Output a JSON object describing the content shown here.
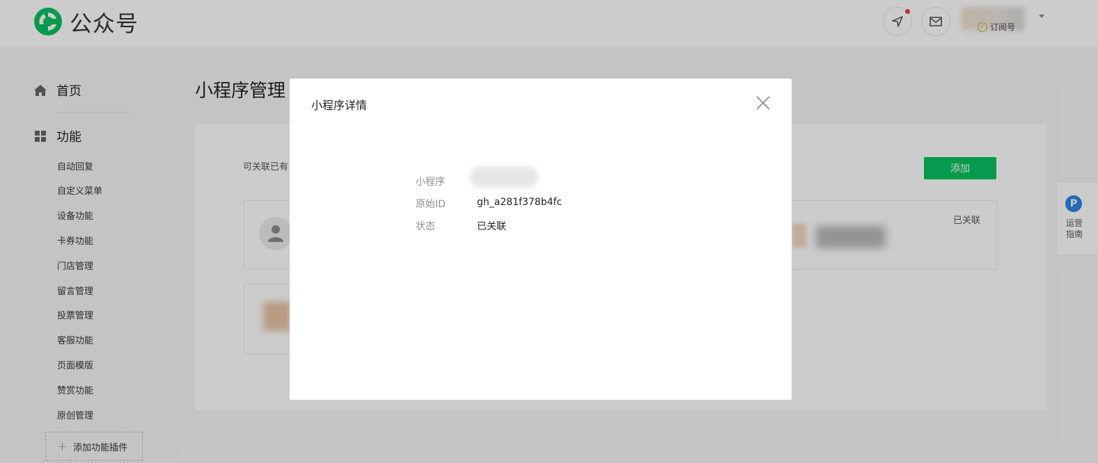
{
  "app": {
    "brand": "公众号",
    "account_type": "订阅号"
  },
  "sidebar": {
    "home": "首页",
    "features": "功能",
    "items": [
      {
        "label": "自动回复"
      },
      {
        "label": "自定义菜单"
      },
      {
        "label": "设备功能"
      },
      {
        "label": "卡券功能"
      },
      {
        "label": "门店管理"
      },
      {
        "label": "留言管理"
      },
      {
        "label": "投票管理"
      },
      {
        "label": "客服功能"
      },
      {
        "label": "页面模版"
      },
      {
        "label": "赞赏功能"
      },
      {
        "label": "原创管理"
      }
    ],
    "add_plugin": "添加功能插件"
  },
  "main": {
    "title": "小程序管理",
    "description": "可关联已有",
    "add_button": "添加",
    "row_status": "已关联"
  },
  "guide": {
    "icon_letter": "P",
    "label": "运营指南"
  },
  "modal": {
    "title": "小程序详情",
    "fields": [
      {
        "label": "小程序",
        "value": ""
      },
      {
        "label": "原始ID",
        "value": "gh_a281f378b4fc"
      },
      {
        "label": "状态",
        "value": "已关联"
      }
    ]
  },
  "colors": {
    "brand_green": "#07c160",
    "notification": "#e64340",
    "guide_blue": "#2e83e6"
  }
}
